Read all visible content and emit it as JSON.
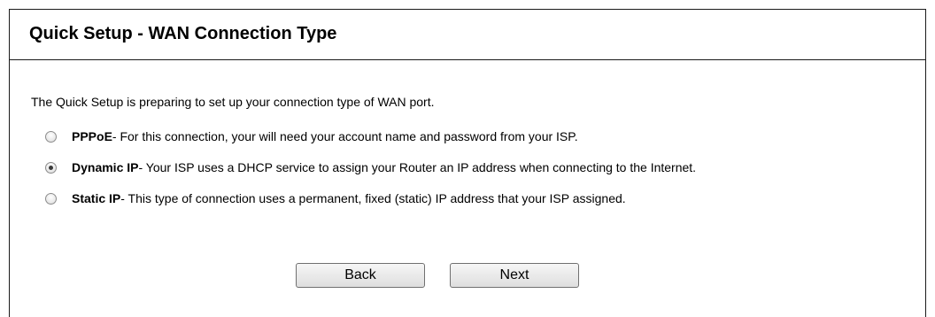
{
  "header": {
    "title": "Quick Setup - WAN Connection Type"
  },
  "intro": "The Quick Setup is preparing to set up your connection type of WAN port.",
  "options": [
    {
      "name": "PPPoE",
      "description": " - For this connection, your will need your account name and password from your ISP.",
      "selected": false
    },
    {
      "name": "Dynamic IP",
      "description": " - Your ISP uses a DHCP service to assign your Router an IP address when connecting to the Internet.",
      "selected": true
    },
    {
      "name": "Static IP",
      "description": " - This type of connection uses a permanent, fixed (static) IP address that your ISP assigned.",
      "selected": false
    }
  ],
  "buttons": {
    "back": "Back",
    "next": "Next"
  }
}
